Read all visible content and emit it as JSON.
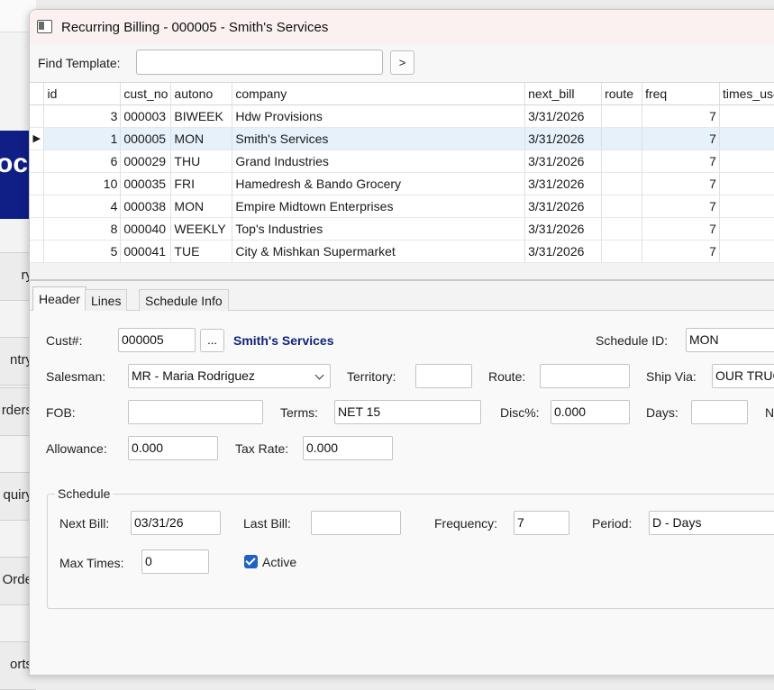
{
  "background": {
    "logo_text": "oc",
    "menu_items": [
      "ry",
      "ntry",
      "rders",
      "quiry",
      "Orde",
      "orts"
    ]
  },
  "window": {
    "title": "Recurring Billing - 000005 - Smith's Services",
    "find_label": "Find Template:",
    "find_value": "",
    "find_button": ">"
  },
  "grid": {
    "columns": [
      "id",
      "cust_no",
      "autono",
      "company",
      "next_bill",
      "route",
      "freq",
      "times_use"
    ],
    "rows": [
      {
        "id": "3",
        "cust_no": "000003",
        "autono": "BIWEEK",
        "company": "Hdw Provisions",
        "next_bill": "3/31/2026",
        "route": "",
        "freq": "7",
        "times_used": ""
      },
      {
        "id": "1",
        "cust_no": "000005",
        "autono": "MON",
        "company": "Smith's Services",
        "next_bill": "3/31/2026",
        "route": "",
        "freq": "7",
        "times_used": ""
      },
      {
        "id": "6",
        "cust_no": "000029",
        "autono": "THU",
        "company": "Grand Industries",
        "next_bill": "3/31/2026",
        "route": "",
        "freq": "7",
        "times_used": ""
      },
      {
        "id": "10",
        "cust_no": "000035",
        "autono": "FRI",
        "company": "Hamedresh & Bando Grocery",
        "next_bill": "3/31/2026",
        "route": "",
        "freq": "7",
        "times_used": ""
      },
      {
        "id": "4",
        "cust_no": "000038",
        "autono": "MON",
        "company": "Empire Midtown Enterprises",
        "next_bill": "3/31/2026",
        "route": "",
        "freq": "7",
        "times_used": ""
      },
      {
        "id": "8",
        "cust_no": "000040",
        "autono": "WEEKLY",
        "company": "Top's Industries",
        "next_bill": "3/31/2026",
        "route": "",
        "freq": "7",
        "times_used": ""
      },
      {
        "id": "5",
        "cust_no": "000041",
        "autono": "TUE",
        "company": "City & Mishkan Supermarket",
        "next_bill": "3/31/2026",
        "route": "",
        "freq": "7",
        "times_used": ""
      }
    ],
    "selected_index": 1
  },
  "tabs": [
    {
      "label": "Header",
      "active": true
    },
    {
      "label": "Lines",
      "active": false
    },
    {
      "label": "Schedule Info",
      "active": false
    }
  ],
  "form": {
    "cust_label": "Cust#:",
    "cust_value": "000005",
    "lookup_button": "...",
    "cust_name": "Smith's Services",
    "schedule_id_label": "Schedule ID:",
    "schedule_id_value": "MON",
    "salesman_label": "Salesman:",
    "salesman_value": "MR - Maria Rodriguez",
    "territory_label": "Territory:",
    "territory_value": "",
    "route_label": "Route:",
    "route_value": "",
    "ship_via_label": "Ship Via:",
    "ship_via_value": "OUR TRUC",
    "fob_label": "FOB:",
    "fob_value": "",
    "terms_label": "Terms:",
    "terms_value": "NET 15",
    "disc_label": "Disc%:",
    "disc_value": "0.000",
    "days_label": "Days:",
    "days_value": "",
    "cutoff_label": "N",
    "allowance_label": "Allowance:",
    "allowance_value": "0.000",
    "tax_rate_label": "Tax Rate:",
    "tax_rate_value": "0.000"
  },
  "schedule": {
    "group_title": "Schedule",
    "next_bill_label": "Next Bill:",
    "next_bill_value": "03/31/26",
    "last_bill_label": "Last Bill:",
    "last_bill_value": "",
    "frequency_label": "Frequency:",
    "frequency_value": "7",
    "period_label": "Period:",
    "period_value": "D - Days",
    "max_times_label": "Max Times:",
    "max_times_value": "0",
    "active_label": "Active",
    "active_checked": true
  }
}
